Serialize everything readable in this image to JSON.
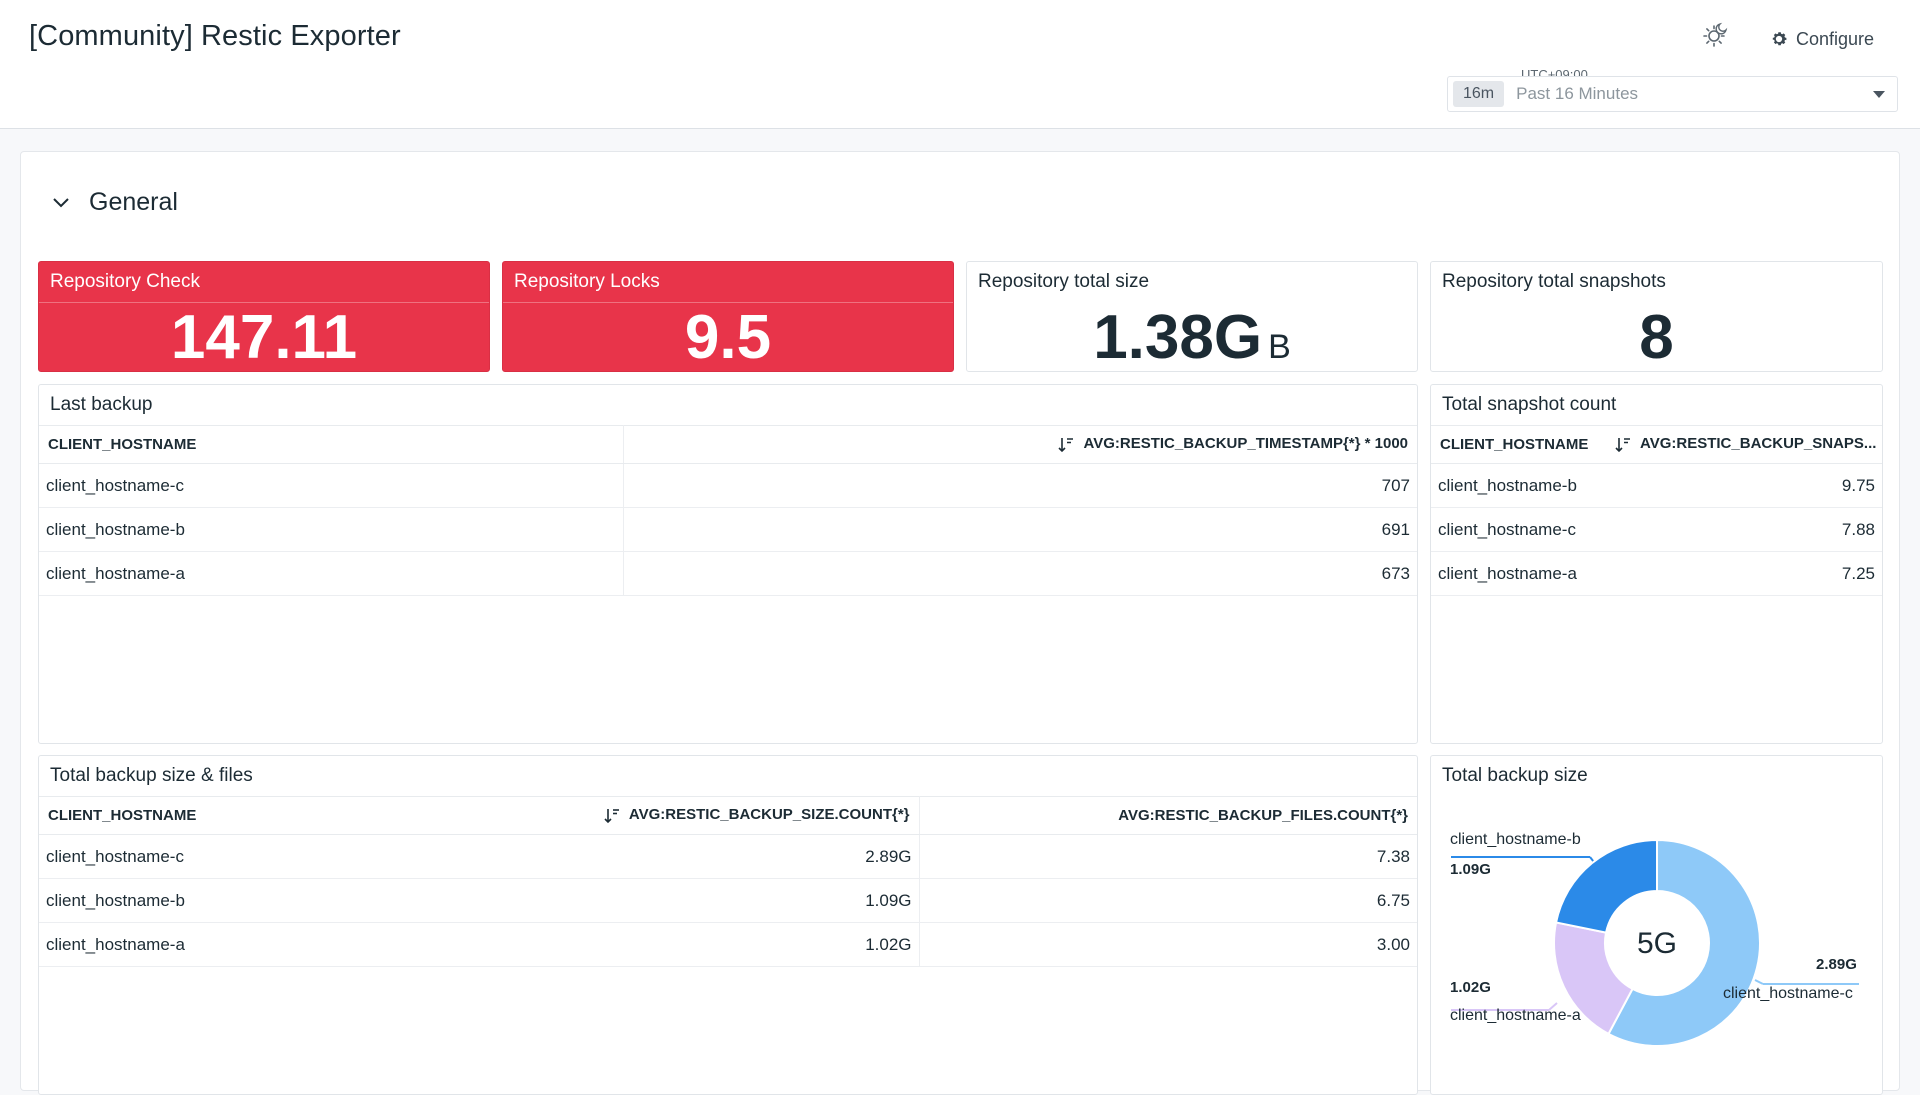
{
  "header": {
    "title": "[Community] Restic Exporter",
    "configure_label": "Configure",
    "timezone": "UTC+09:00",
    "time_chip": "16m",
    "time_range": "Past 16 Minutes"
  },
  "group": {
    "title": "General"
  },
  "query_values": [
    {
      "title": "Repository Check",
      "value": "147.11",
      "unit": ""
    },
    {
      "title": "Repository Locks",
      "value": "9.5",
      "unit": ""
    },
    {
      "title": "Repository total size",
      "value": "1.38G",
      "unit": "B"
    },
    {
      "title": "Repository total snapshots",
      "value": "8",
      "unit": ""
    }
  ],
  "last_backup": {
    "title": "Last backup",
    "columns": [
      "CLIENT_HOSTNAME",
      "AVG:RESTIC_BACKUP_TIMESTAMP{*} * 1000"
    ],
    "rows": [
      {
        "host": "client_hostname-c",
        "value": "707"
      },
      {
        "host": "client_hostname-b",
        "value": "691"
      },
      {
        "host": "client_hostname-a",
        "value": "673"
      }
    ]
  },
  "snapshot_count": {
    "title": "Total snapshot count",
    "columns": [
      "CLIENT_HOSTNAME",
      "AVG:RESTIC_BACKUP_SNAPS..."
    ],
    "rows": [
      {
        "host": "client_hostname-b",
        "value": "9.75"
      },
      {
        "host": "client_hostname-c",
        "value": "7.88"
      },
      {
        "host": "client_hostname-a",
        "value": "7.25"
      }
    ]
  },
  "size_files": {
    "title": "Total backup size & files",
    "columns": [
      "CLIENT_HOSTNAME",
      "AVG:RESTIC_BACKUP_SIZE.COUNT{*}",
      "AVG:RESTIC_BACKUP_FILES.COUNT{*}"
    ],
    "rows": [
      {
        "host": "client_hostname-c",
        "size": "2.89G",
        "files": "7.38"
      },
      {
        "host": "client_hostname-b",
        "size": "1.09G",
        "files": "6.75"
      },
      {
        "host": "client_hostname-a",
        "size": "1.02G",
        "files": "3.00"
      }
    ]
  },
  "backup_size": {
    "title": "Total backup size",
    "center": "5G",
    "labels": {
      "b_name": "client_hostname-b",
      "b_val": "1.09G",
      "a_name": "client_hostname-a",
      "a_val": "1.02G",
      "c_name": "client_hostname-c",
      "c_val": "2.89G"
    }
  },
  "chart_data": {
    "type": "pie",
    "title": "Total backup size",
    "center_label": "5G",
    "categories": [
      "client_hostname-c",
      "client_hostname-a",
      "client_hostname-b"
    ],
    "values": [
      2.89,
      1.02,
      1.09
    ],
    "display_values": [
      "2.89G",
      "1.02G",
      "1.09G"
    ],
    "colors": [
      "#8ec9f8",
      "#d9c6f7",
      "#2b8ae8"
    ]
  },
  "colors": {
    "alert_red": "#e8344a",
    "accent_blue": "#2b8ae8"
  }
}
